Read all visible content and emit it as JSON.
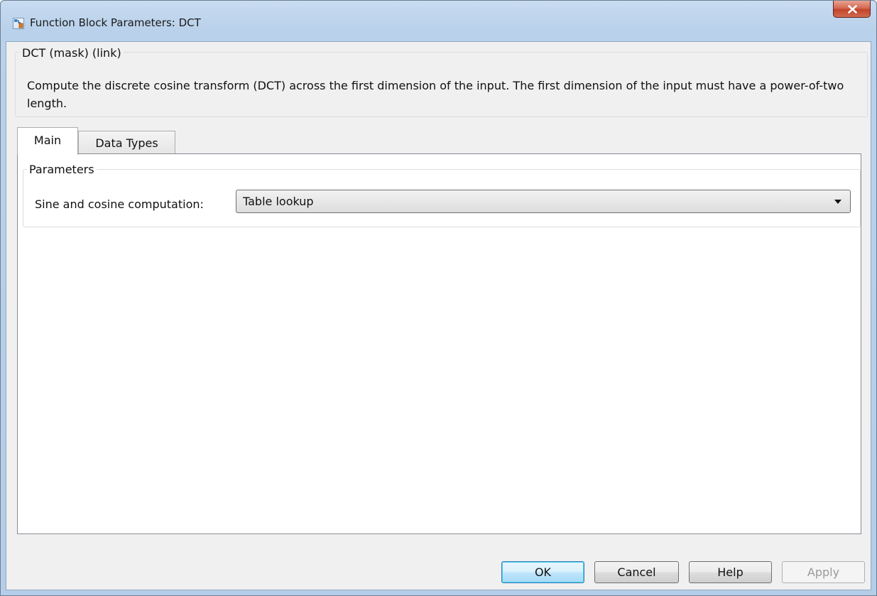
{
  "window": {
    "title": "Function Block Parameters: DCT"
  },
  "description": {
    "group_title": "DCT (mask) (link)",
    "text": "Compute the discrete cosine transform (DCT) across the first dimension of the input. The first dimension of the input must have a power-of-two length."
  },
  "tabs": [
    {
      "label": "Main",
      "active": true
    },
    {
      "label": "Data Types",
      "active": false
    }
  ],
  "parameters": {
    "group_title": "Parameters",
    "sine_cosine": {
      "label": "Sine and cosine computation:",
      "value": "Table lookup"
    }
  },
  "buttons": {
    "ok": "OK",
    "cancel": "Cancel",
    "help": "Help",
    "apply": "Apply"
  },
  "icons": {
    "window_icon": "simulink-block-icon",
    "close": "close-icon",
    "dropdown": "chevron-down-icon"
  },
  "colors": {
    "titlebar": "#b9d1ea",
    "client_bg": "#f0f0f0",
    "close_button": "#c2442a",
    "default_button_border": "#3c7fb1"
  }
}
